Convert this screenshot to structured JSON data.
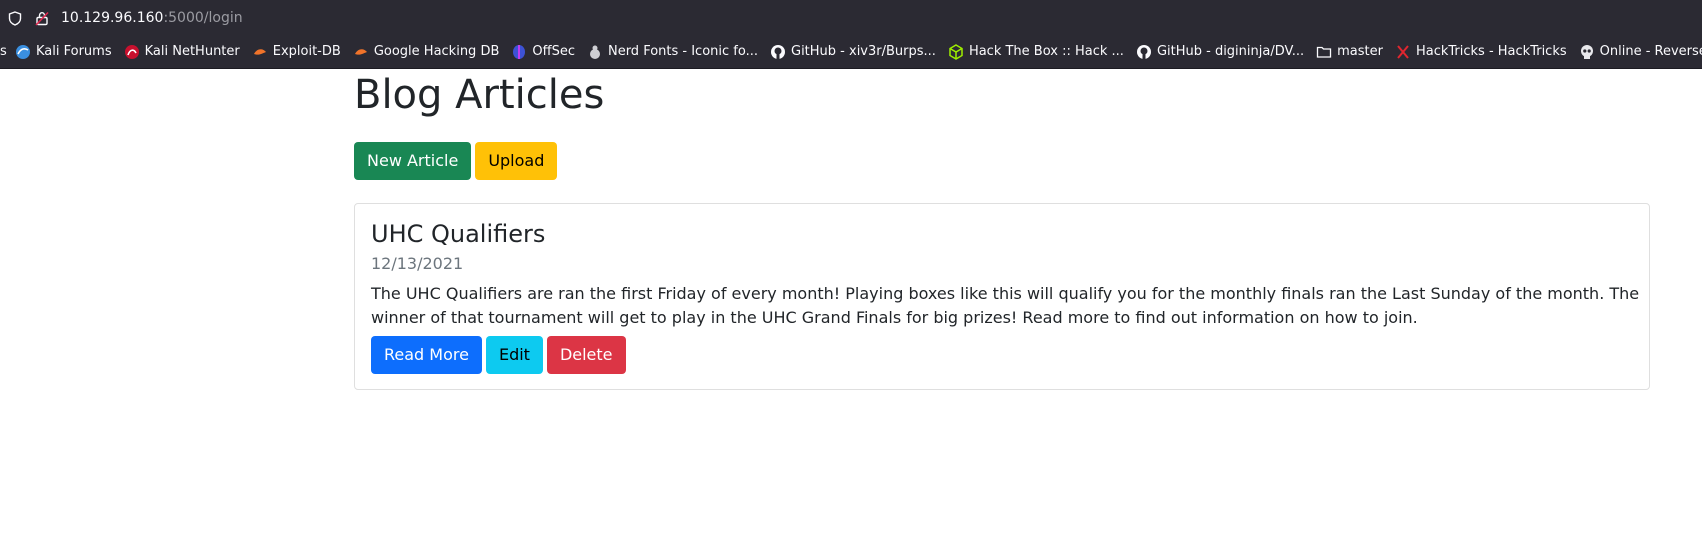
{
  "browser": {
    "url_host": "10.129.96.160",
    "url_rest": ":5000/login",
    "bookmarks": [
      {
        "label": "s",
        "icon": "cut-off-icon"
      },
      {
        "label": "Kali Forums",
        "icon": "kali-forums-icon"
      },
      {
        "label": "Kali NetHunter",
        "icon": "kali-nethunter-icon"
      },
      {
        "label": "Exploit-DB",
        "icon": "exploit-db-icon"
      },
      {
        "label": "Google Hacking DB",
        "icon": "ghdb-icon"
      },
      {
        "label": "OffSec",
        "icon": "offsec-icon"
      },
      {
        "label": "Nerd Fonts - Iconic fo...",
        "icon": "nerd-fonts-icon"
      },
      {
        "label": "GitHub - xiv3r/Burps...",
        "icon": "github-icon"
      },
      {
        "label": "Hack The Box :: Hack ...",
        "icon": "hackthebox-icon"
      },
      {
        "label": "GitHub - digininja/DV...",
        "icon": "github-icon"
      },
      {
        "label": "master",
        "icon": "folder-icon"
      },
      {
        "label": "HackTricks - HackTricks",
        "icon": "hacktricks-icon"
      },
      {
        "label": "Online - Reverse Shel...",
        "icon": "skull-icon"
      }
    ]
  },
  "page": {
    "title": "Blog Articles",
    "new_article_label": "New Article",
    "upload_label": "Upload"
  },
  "article": {
    "title": "UHC Qualifiers",
    "date": "12/13/2021",
    "body": "The UHC Qualifiers are ran the first Friday of every month! Playing boxes like this will qualify you for the monthly finals ran the Last Sunday of the month. The winner of that tournament will get to play in the UHC Grand Finals for big prizes! Read more to find out information on how to join.",
    "read_more_label": "Read More",
    "edit_label": "Edit",
    "delete_label": "Delete"
  },
  "colors": {
    "chrome_bg": "#2b2a33",
    "success": "#198754",
    "warning": "#ffc107",
    "primary": "#0d6efd",
    "info": "#0dcaf0",
    "danger": "#dc3545"
  }
}
